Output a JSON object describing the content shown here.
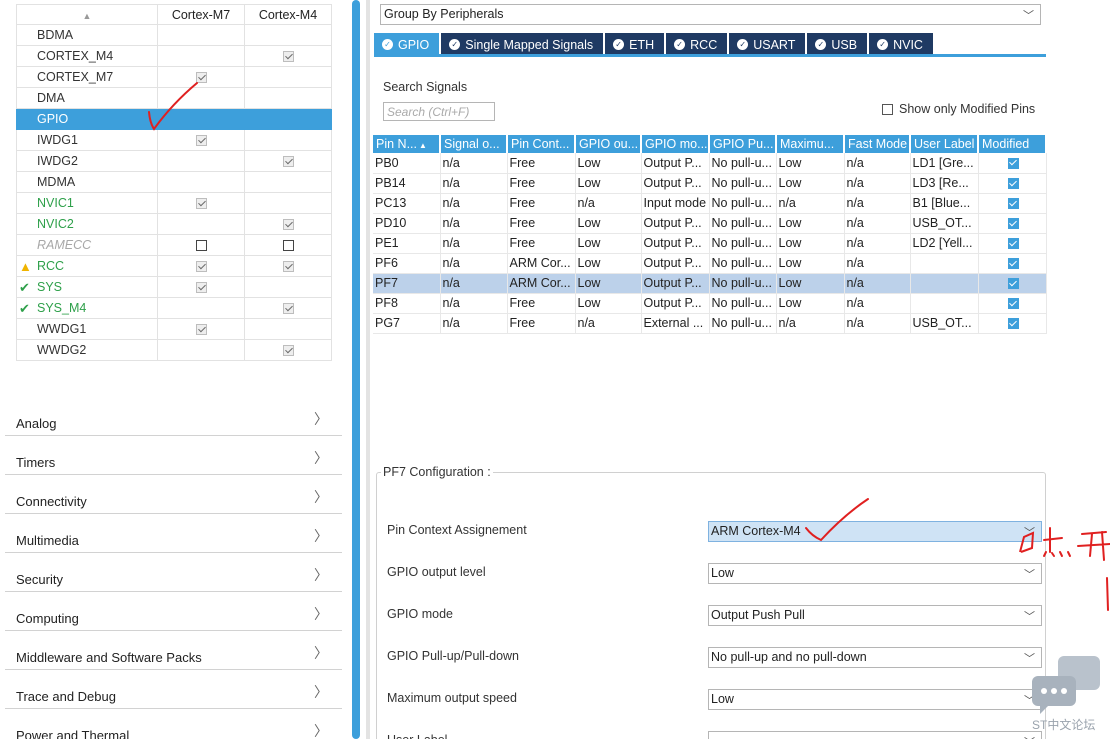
{
  "peripheral_table": {
    "headers": [
      "Cortex-M7",
      "Cortex-M4"
    ],
    "rows": [
      {
        "name": "BDMA",
        "m7": "none",
        "m4": "none",
        "style": "normal",
        "prefix": ""
      },
      {
        "name": "CORTEX_M4",
        "m7": "none",
        "m4": "checked",
        "style": "normal",
        "prefix": ""
      },
      {
        "name": "CORTEX_M7",
        "m7": "checked",
        "m4": "none",
        "style": "normal",
        "prefix": ""
      },
      {
        "name": "DMA",
        "m7": "none",
        "m4": "none",
        "style": "normal",
        "prefix": ""
      },
      {
        "name": "GPIO",
        "m7": "none",
        "m4": "none",
        "style": "selected",
        "prefix": ""
      },
      {
        "name": "IWDG1",
        "m7": "checked",
        "m4": "none",
        "style": "normal",
        "prefix": ""
      },
      {
        "name": "IWDG2",
        "m7": "none",
        "m4": "checked",
        "style": "normal",
        "prefix": ""
      },
      {
        "name": "MDMA",
        "m7": "none",
        "m4": "none",
        "style": "normal",
        "prefix": ""
      },
      {
        "name": "NVIC1",
        "m7": "checked",
        "m4": "none",
        "style": "green",
        "prefix": ""
      },
      {
        "name": "NVIC2",
        "m7": "none",
        "m4": "checked",
        "style": "green",
        "prefix": ""
      },
      {
        "name": "RAMECC",
        "m7": "blank",
        "m4": "blank",
        "style": "gray",
        "prefix": ""
      },
      {
        "name": "RCC",
        "m7": "checked",
        "m4": "checked",
        "style": "green",
        "prefix": "warning"
      },
      {
        "name": "SYS",
        "m7": "checked",
        "m4": "none",
        "style": "green",
        "prefix": "ok"
      },
      {
        "name": "SYS_M4",
        "m7": "none",
        "m4": "checked",
        "style": "green",
        "prefix": "ok"
      },
      {
        "name": "WWDG1",
        "m7": "checked",
        "m4": "none",
        "style": "normal",
        "prefix": ""
      },
      {
        "name": "WWDG2",
        "m7": "none",
        "m4": "checked",
        "style": "normal",
        "prefix": ""
      }
    ]
  },
  "categories": [
    "Analog",
    "Timers",
    "Connectivity",
    "Multimedia",
    "Security",
    "Computing",
    "Middleware and Software Packs",
    "Trace and Debug",
    "Power and Thermal"
  ],
  "group_by": "Group By Peripherals",
  "tabs": [
    "GPIO",
    "Single Mapped Signals",
    "ETH",
    "RCC",
    "USART",
    "USB",
    "NVIC"
  ],
  "active_tab": "GPIO",
  "search": {
    "label": "Search Signals",
    "placeholder": "Search (Ctrl+F)"
  },
  "show_modified_label": "Show only Modified Pins",
  "gpio_table": {
    "headers": [
      "Pin N...",
      "Signal o...",
      "Pin Cont...",
      "GPIO ou...",
      "GPIO mo...",
      "GPIO Pu...",
      "Maximu...",
      "Fast Mode",
      "User Label",
      "Modified"
    ],
    "rows": [
      [
        "PB0",
        "n/a",
        "Free",
        "Low",
        "Output P...",
        "No pull-u...",
        "Low",
        "n/a",
        "LD1 [Gre...",
        "checked"
      ],
      [
        "PB14",
        "n/a",
        "Free",
        "Low",
        "Output P...",
        "No pull-u...",
        "Low",
        "n/a",
        "LD3 [Re...",
        "checked"
      ],
      [
        "PC13",
        "n/a",
        "Free",
        "n/a",
        "Input mode",
        "No pull-u...",
        "n/a",
        "n/a",
        "B1 [Blue...",
        "checked"
      ],
      [
        "PD10",
        "n/a",
        "Free",
        "Low",
        "Output P...",
        "No pull-u...",
        "Low",
        "n/a",
        "USB_OT...",
        "checked"
      ],
      [
        "PE1",
        "n/a",
        "Free",
        "Low",
        "Output P...",
        "No pull-u...",
        "Low",
        "n/a",
        "LD2 [Yell...",
        "checked"
      ],
      [
        "PF6",
        "n/a",
        "ARM Cor...",
        "Low",
        "Output P...",
        "No pull-u...",
        "Low",
        "n/a",
        "",
        "checked"
      ],
      [
        "PF7",
        "n/a",
        "ARM Cor...",
        "Low",
        "Output P...",
        "No pull-u...",
        "Low",
        "n/a",
        "",
        "checked"
      ],
      [
        "PF8",
        "n/a",
        "Free",
        "Low",
        "Output P...",
        "No pull-u...",
        "Low",
        "n/a",
        "",
        "checked"
      ],
      [
        "PG7",
        "n/a",
        "Free",
        "n/a",
        "External ...",
        "No pull-u...",
        "n/a",
        "n/a",
        "USB_OT...",
        "checked"
      ]
    ],
    "highlighted_row": "PF7"
  },
  "config": {
    "title": "PF7 Configuration :",
    "fields": [
      {
        "label": "Pin Context Assignement",
        "value": "ARM Cortex-M4"
      },
      {
        "label": "GPIO output level",
        "value": "Low"
      },
      {
        "label": "GPIO mode",
        "value": "Output Push Pull"
      },
      {
        "label": "GPIO Pull-up/Pull-down",
        "value": "No pull-up and no pull-down"
      },
      {
        "label": "Maximum output speed",
        "value": "Low"
      },
      {
        "label": "User Label",
        "value": ""
      }
    ]
  },
  "watermark": "ST中文论坛",
  "colors": {
    "accent": "#3d9fdb",
    "tab_dark": "#1f3a63",
    "row_highlight": "#bcd1ea",
    "annotation": "#e02020",
    "green": "#2ea04a"
  }
}
